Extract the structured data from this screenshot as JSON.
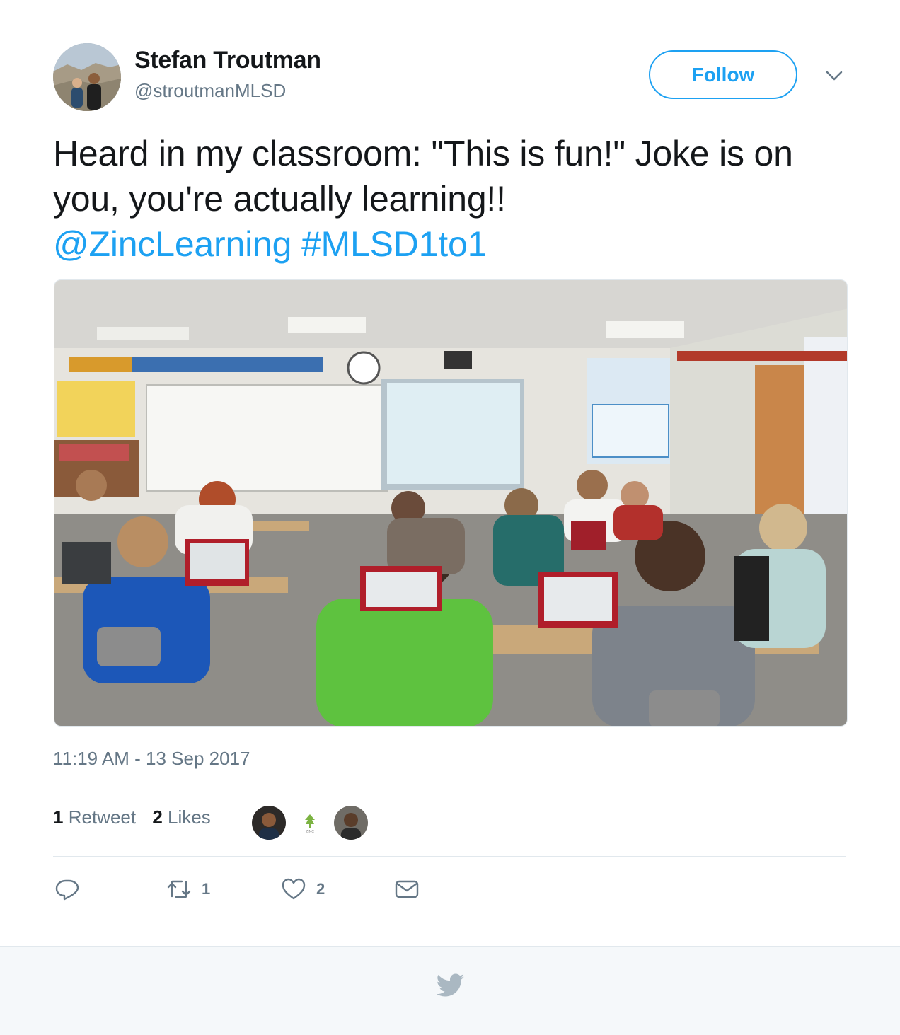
{
  "user": {
    "display_name": "Stefan Troutman",
    "handle": "@stroutmanMLSD",
    "avatar_icon": "user-avatar"
  },
  "header": {
    "follow_label": "Follow",
    "caret_icon": "chevron-down-icon"
  },
  "tweet": {
    "text_plain": "Heard in my classroom: \"This is fun!\" Joke is on you, you're actually learning!!",
    "mention": "@ZincLearning",
    "hashtag": "#MLSD1to1"
  },
  "timestamp": "11:19 AM - 13 Sep 2017",
  "stats": {
    "retweets_count": "1",
    "retweets_label": "Retweet",
    "likes_count": "2",
    "likes_label": "Likes"
  },
  "likers": [
    {
      "name": "liker-avatar-1"
    },
    {
      "name": "liker-avatar-zinc",
      "label": "ZINC"
    },
    {
      "name": "liker-avatar-2"
    }
  ],
  "actions": {
    "reply_icon": "reply-icon",
    "retweet_icon": "retweet-icon",
    "retweet_count": "1",
    "like_icon": "heart-icon",
    "like_count": "2",
    "dm_icon": "envelope-icon"
  },
  "colors": {
    "accent": "#1da1f2",
    "secondary_text": "#657786",
    "border": "#e1e8ed",
    "footer_bg": "#f5f8fa"
  }
}
